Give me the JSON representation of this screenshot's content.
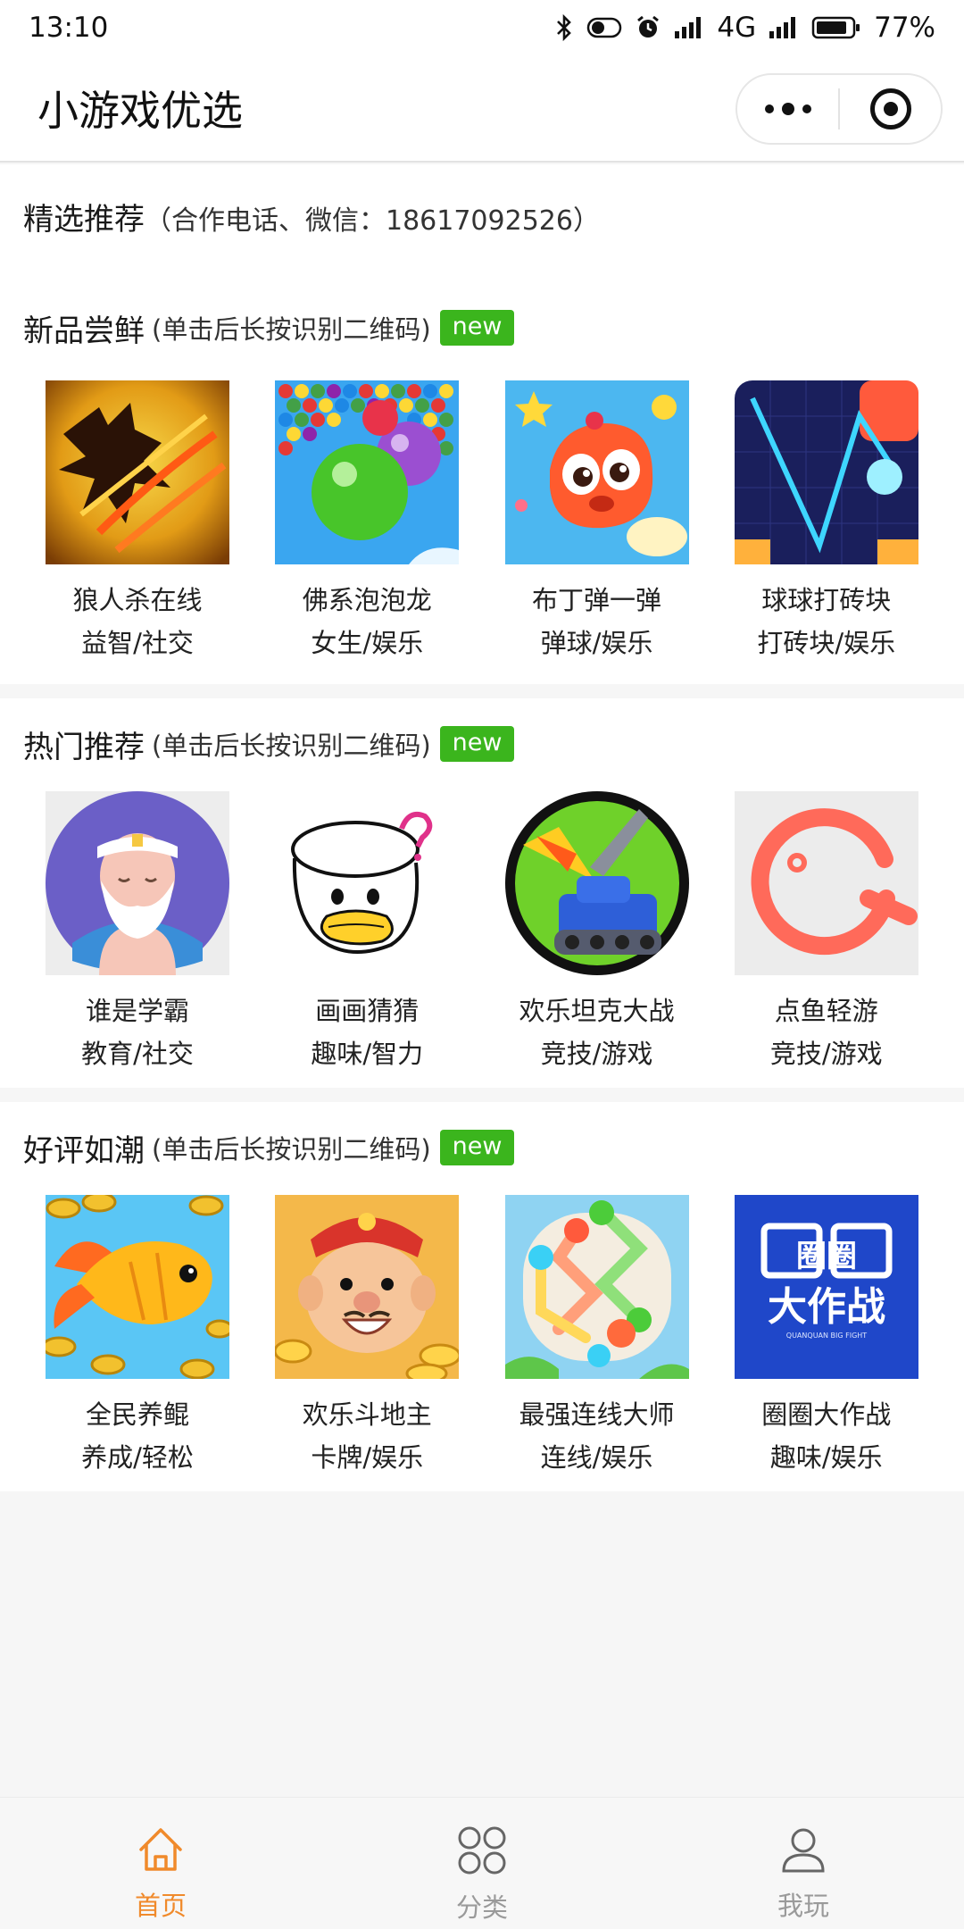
{
  "status_bar": {
    "time": "13:10",
    "network": "4G",
    "battery": "77%"
  },
  "nav": {
    "title": "小游戏优选"
  },
  "featured": {
    "title": "精选推荐",
    "contact": "（合作电话、微信：18617092526）"
  },
  "sections": [
    {
      "title": "新品尝鲜",
      "note": "(单击后长按识别二维码)",
      "badge": "new",
      "games": [
        {
          "name": "狼人杀在线",
          "category": "益智/社交",
          "icon": "werewolf-icon"
        },
        {
          "name": "佛系泡泡龙",
          "category": "女生/娱乐",
          "icon": "bubble-shooter-icon"
        },
        {
          "name": "布丁弹一弹",
          "category": "弹球/娱乐",
          "icon": "pudding-icon"
        },
        {
          "name": "球球打砖块",
          "category": "打砖块/娱乐",
          "icon": "brick-ball-icon"
        }
      ]
    },
    {
      "title": "热门推荐",
      "note": "(单击后长按识别二维码)",
      "badge": "new",
      "games": [
        {
          "name": "谁是学霸",
          "category": "教育/社交",
          "icon": "scholar-icon"
        },
        {
          "name": "画画猜猜",
          "category": "趣味/智力",
          "icon": "duck-drawing-icon"
        },
        {
          "name": "欢乐坦克大战",
          "category": "竞技/游戏",
          "icon": "tank-icon"
        },
        {
          "name": "点鱼轻游",
          "category": "竞技/游戏",
          "icon": "fish-circle-icon"
        }
      ]
    },
    {
      "title": "好评如潮",
      "note": "(单击后长按识别二维码)",
      "badge": "new",
      "games": [
        {
          "name": "全民养鲲",
          "category": "养成/轻松",
          "icon": "gold-fish-icon"
        },
        {
          "name": "欢乐斗地主",
          "category": "卡牌/娱乐",
          "icon": "landlord-icon"
        },
        {
          "name": "最强连线大师",
          "category": "连线/娱乐",
          "icon": "connect-lines-icon"
        },
        {
          "name": "圈圈大作战",
          "category": "趣味/娱乐",
          "icon": "circle-battle-icon"
        }
      ],
      "circle_battle_logo": {
        "top": "圈圈",
        "main": "大作战",
        "small": "QUANQUAN BIG FIGHT"
      }
    }
  ],
  "tabs": [
    {
      "label": "首页",
      "icon": "home-icon",
      "active": true
    },
    {
      "label": "分类",
      "icon": "category-icon",
      "active": false
    },
    {
      "label": "我玩",
      "icon": "user-icon",
      "active": false
    }
  ],
  "colors": {
    "accent": "#f08a2b",
    "badge": "#3bb51d",
    "inactive_tab": "#9a9a9a"
  }
}
